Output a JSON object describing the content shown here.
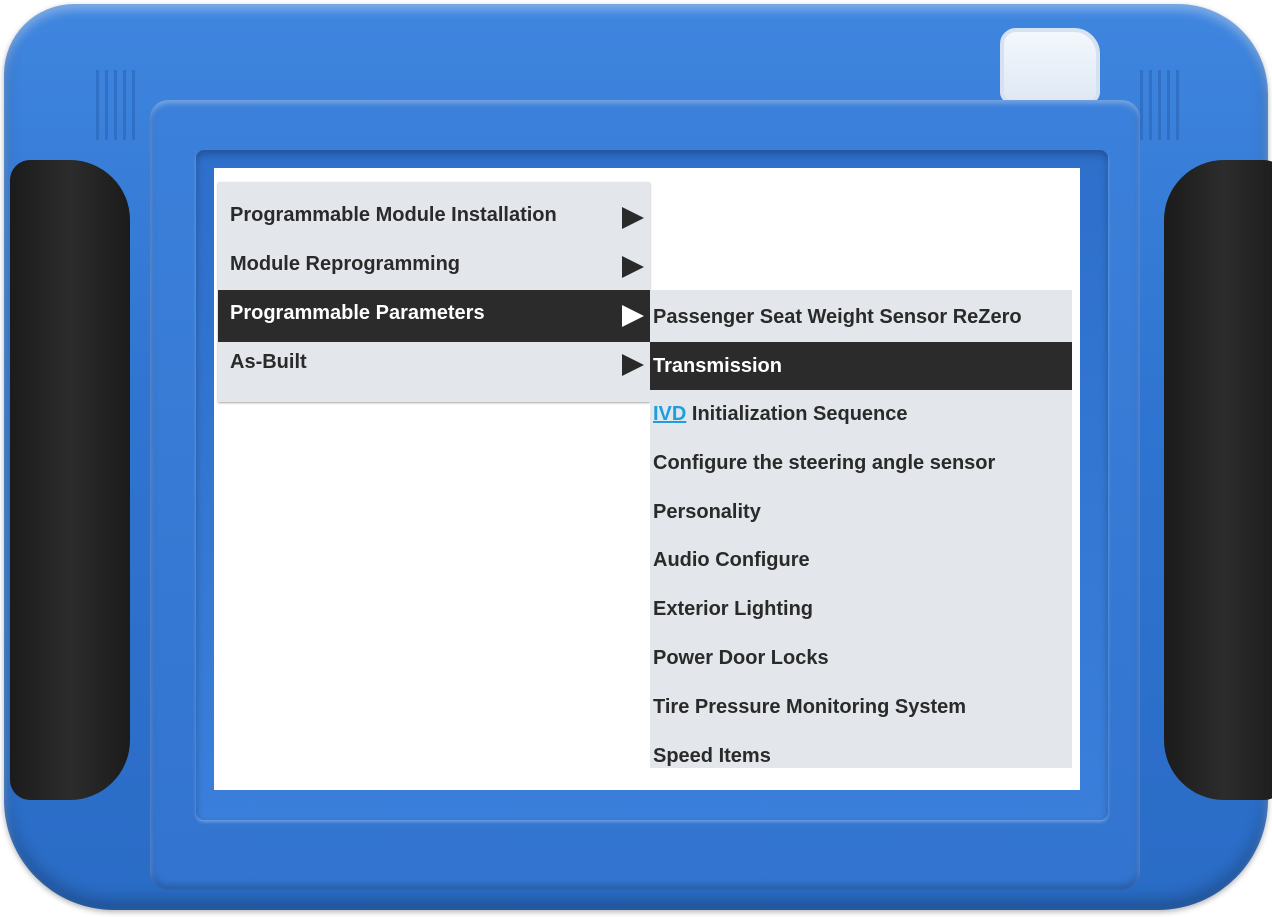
{
  "menu_level1": {
    "items": [
      {
        "label": "Programmable Module Installation"
      },
      {
        "label": "Module Reprogramming"
      },
      {
        "label": "Programmable Parameters",
        "selected": true
      },
      {
        "label": "As-Built"
      }
    ]
  },
  "menu_level2": {
    "items": [
      {
        "label": "Passenger Seat Weight Sensor ReZero"
      },
      {
        "label": "Transmission",
        "selected": true
      },
      {
        "link": "IVD",
        "label": " Initialization Sequence"
      },
      {
        "label": "Configure the steering angle sensor"
      },
      {
        "label": "Personality"
      },
      {
        "label": "Audio Configure"
      },
      {
        "label": "Exterior Lighting"
      },
      {
        "label": "Power Door Locks"
      },
      {
        "label": "Tire Pressure Monitoring System"
      },
      {
        "label": "Speed Items"
      }
    ]
  },
  "colors": {
    "housing": "#3479d4",
    "grip": "#222222",
    "menu_bg": "#e3e6ea",
    "selected_bg": "#2b2b2b",
    "link": "#1e9ee0"
  }
}
